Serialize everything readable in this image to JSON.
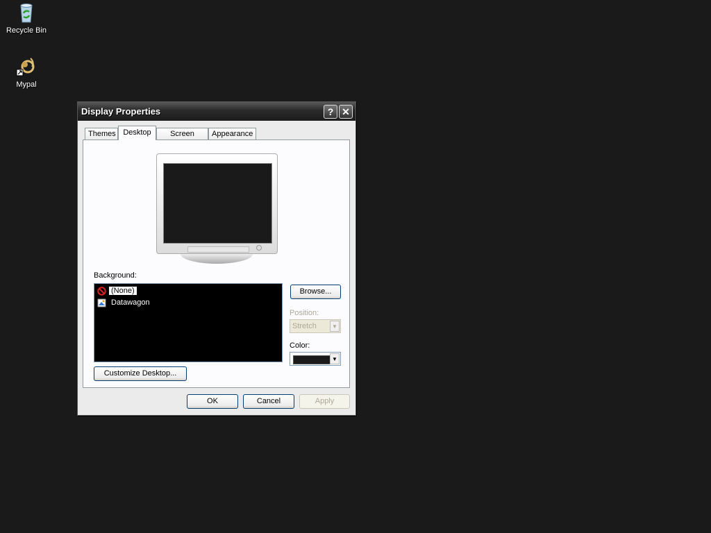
{
  "desktop": {
    "icons": [
      {
        "label": "Recycle Bin",
        "icon": "recycle-bin-icon"
      },
      {
        "label": "Mypal",
        "icon": "mypal-icon"
      }
    ],
    "background_color": "#1a1a1a"
  },
  "window": {
    "title": "Display Properties",
    "help_label": "?",
    "close_label": "✕",
    "tabs": [
      {
        "label": "Themes",
        "active": false
      },
      {
        "label": "Desktop",
        "active": true
      },
      {
        "label": "Screen Saver",
        "active": false
      },
      {
        "label": "Appearance",
        "active": false
      }
    ],
    "desktop_tab": {
      "background_label": "Background:",
      "background_items": [
        {
          "label": "(None)",
          "icon": "none-icon",
          "selected": true
        },
        {
          "label": "Datawagon",
          "icon": "image-file-icon",
          "selected": false
        }
      ],
      "browse_label": "Browse...",
      "position_label": "Position:",
      "position_value": "Stretch",
      "color_label": "Color:",
      "color_value": "#1a1a1a",
      "customize_label": "Customize Desktop..."
    },
    "buttons": {
      "ok": "OK",
      "cancel": "Cancel",
      "apply": "Apply"
    }
  }
}
